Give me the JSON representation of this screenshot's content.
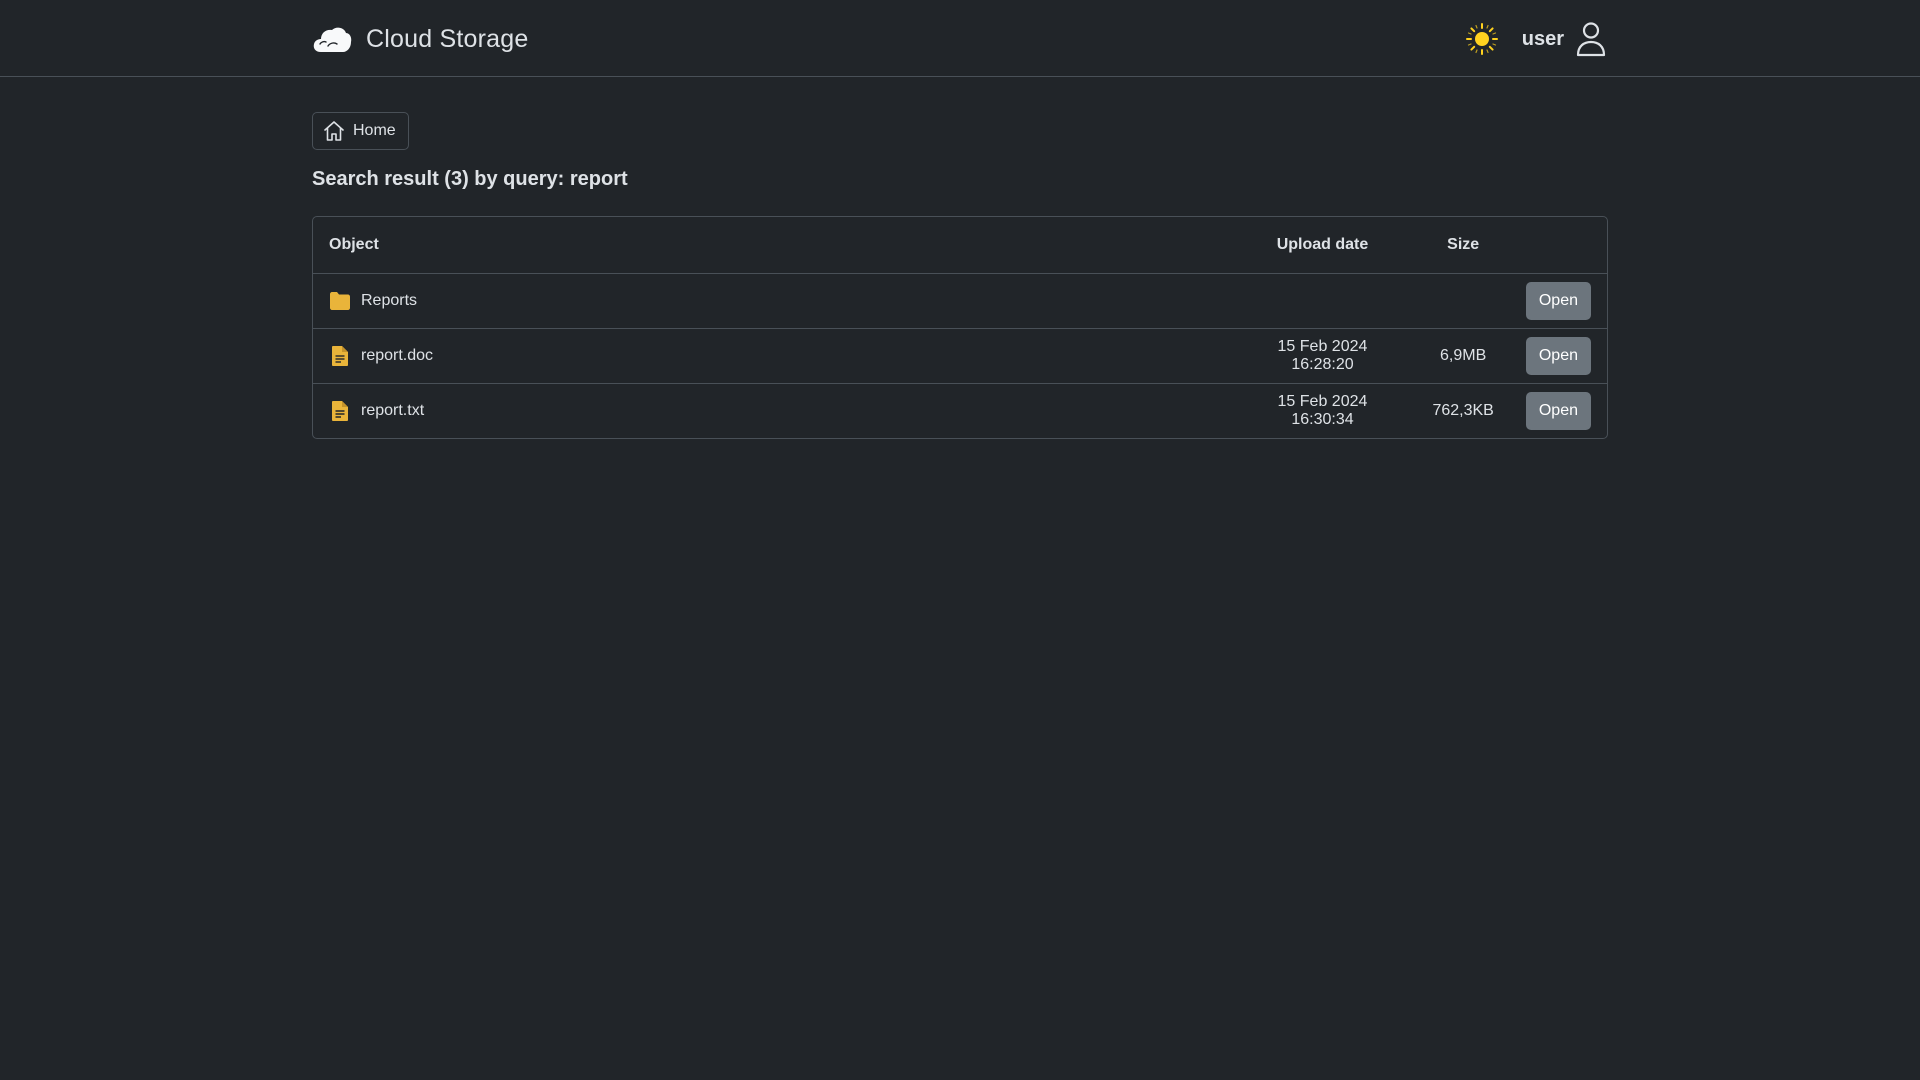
{
  "app": {
    "title": "Cloud Storage",
    "logo_icon": "cloud-icon"
  },
  "header": {
    "theme_icon": "sun-icon",
    "user_name": "user",
    "user_icon": "person-icon"
  },
  "breadcrumb": {
    "home_label": "Home",
    "home_icon": "house-icon"
  },
  "search": {
    "title": "Search result (3) by query: report"
  },
  "table": {
    "columns": {
      "object": "Object",
      "upload_date": "Upload date",
      "size": "Size"
    },
    "rows": [
      {
        "type": "folder",
        "icon": "folder-icon",
        "name": "Reports",
        "upload_date": "",
        "size": "",
        "action": "Open"
      },
      {
        "type": "file",
        "icon": "file-icon",
        "name": "report.doc",
        "upload_date": "15 Feb 2024 16:28:20",
        "size": "6,9MB",
        "action": "Open"
      },
      {
        "type": "file",
        "icon": "file-icon",
        "name": "report.txt",
        "upload_date": "15 Feb 2024 16:30:34",
        "size": "762,3KB",
        "action": "Open"
      }
    ]
  },
  "colors": {
    "background": "#212529",
    "border": "#495057",
    "text": "#dee2e6",
    "accent_icon": "#e9b43a",
    "sun": "#ffd21f",
    "button": "#6c757d"
  }
}
